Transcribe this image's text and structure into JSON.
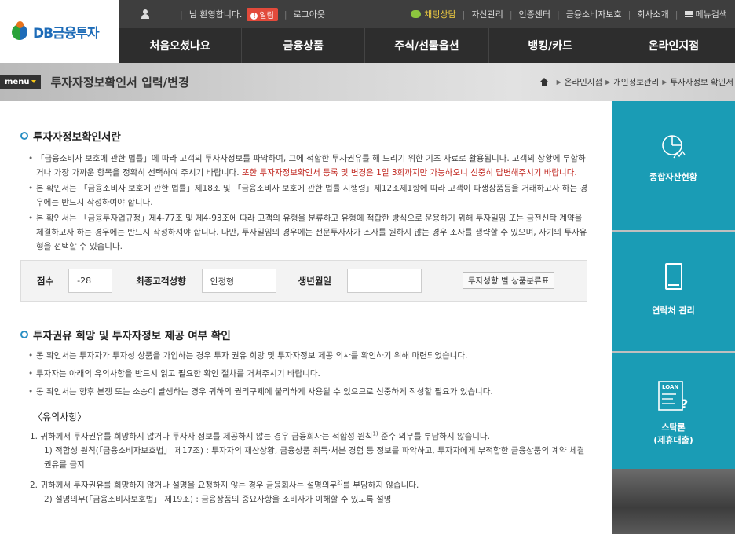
{
  "logo": {
    "text": "DB금융투자"
  },
  "topbar": {
    "greeting": "님 환영합니다.",
    "alarm": "알림",
    "logout": "로그아웃",
    "chat": "채팅상담",
    "links": [
      "자산관리",
      "인증센터",
      "금융소비자보호",
      "회사소개"
    ],
    "menu_search": "메뉴검색"
  },
  "nav": [
    "처음오셨나요",
    "금융상품",
    "주식/선물옵션",
    "뱅킹/카드",
    "온라인지점"
  ],
  "title_band": {
    "menu_label": "menu",
    "page_title": "투자자정보확인서 입력/변경",
    "breadcrumb": [
      "온라인지점",
      "개인정보관리",
      "투자자정보 확인서"
    ]
  },
  "section1": {
    "title": "투자자정보확인서란",
    "b1_a": "「금융소비자 보호에 관한 법률」에 따라 고객의 투자자정보를 파악하여, 그에 적합한 투자권유를 해 드리기 위한 기초 자료로 활용됩니다. 고객의 상황에 부합하거나 가장 가까운 항목을 정확히 선택하여 주시기 바랍니다. ",
    "b1_red": "또한 투자자정보확인서 등록 및 변경은 1일 3회까지만 가능하오니 신중히 답변해주시기 바랍니다.",
    "b2": "본 확인서는 「금융소비자 보호에 관한 법률」제18조 및 「금융소비자 보호에 관한 법률 시행령」제12조제1항에 따라 고객이 파생상품등을 거래하고자 하는 경우에는 반드시 작성하여야 합니다.",
    "b3": "본 확인서는 「금융투자업규정」제4-77조 및 제4-93조에 따라 고객의 유형을 분류하고 유형에 적합한 방식으로 운용하기 위해 투자일임 또는 금전신탁 계약을 체결하고자 하는 경우에는 반드시 작성하셔야 합니다. 다만, 투자일임의 경우에는 전문투자자가 조사를 원하지 않는 경우 조사를 생략할 수 있으며, 자기의 투자유형을 선택할 수 있습니다."
  },
  "score": {
    "score_label": "점수",
    "score_value": "-28",
    "type_label": "최종고객성향",
    "type_value": "안정형",
    "birth_label": "생년월일",
    "birth_value": "",
    "table_button": "투자성향 별 상품분류표"
  },
  "section2": {
    "title": "투자권유 희망 및 투자자정보 제공 여부 확인",
    "b1": "동 확인서는 투자자가 투자성 상품을 가입하는 경우 투자 권유 희망 및 투자자정보 제공 의사를 확인하기 위해 마련되었습니다.",
    "b2": "투자자는 아래의 유의사항을 반드시 읽고 필요한 확인 절차를 거쳐주시기 바랍니다.",
    "b3": "동 확인서는 향후 분쟁 또는 소송이 발생하는 경우 귀하의 권리구제에 불리하게 사용될 수 있으므로 신중하게 작성할 필요가 있습니다."
  },
  "notice": {
    "title": "〈유의사항〉",
    "n1_a": "1. 귀하께서 투자권유를 희망하지 않거나 투자자 정보를 제공하지 않는 경우 금융회사는 적합성 원칙",
    "n1_sup": "1)",
    "n1_b": " 준수 의무를 부담하지 않습니다.",
    "n1_sub": "1) 적합성 원칙(「금융소비자보호법」 제17조) : 투자자의 재산상황, 금융상품 취득·처분 경험 등 정보를 파악하고, 투자자에게 부적합한 금융상품의 계약 체결 권유를 금지",
    "n2_a": "2. 귀하께서 투자권유를 희망하지 않거나 설명을 요청하지 않는 경우 금융회사는 설명의무",
    "n2_sup": "2)",
    "n2_b": "를 부담하지 않습니다.",
    "n2_sub": "2) 설명의무(「금융소비자보호법」 제19조) : 금융상품의 중요사항을 소비자가 이해할 수 있도록 설명"
  },
  "side": {
    "tile1": "종합자산현황",
    "tile2": "연락처 관리",
    "tile3_line1": "스탁론",
    "tile3_line2": "(제휴대출)",
    "loan_icon_text": "LOAN"
  }
}
